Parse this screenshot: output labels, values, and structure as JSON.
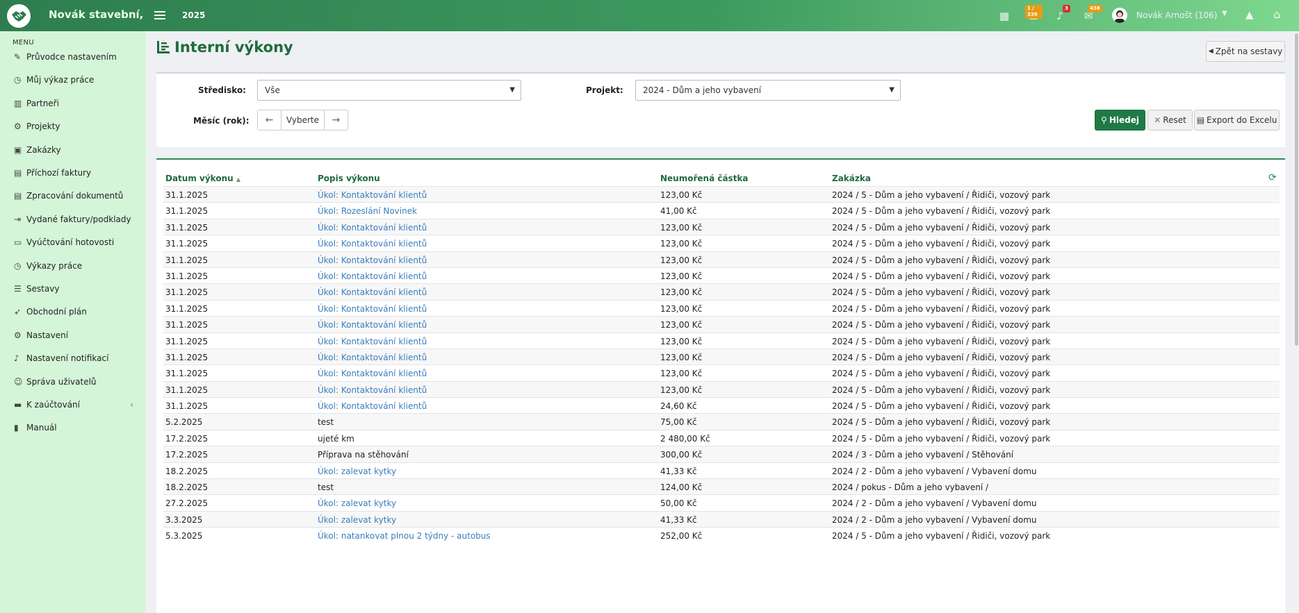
{
  "app": {
    "brand": "Novák stavební,",
    "year": "2025"
  },
  "navbar": {
    "tasks_badge": "1 / 339",
    "notifications_badge": "3",
    "messages_badge": "438",
    "user_name": "Novák Arnošt (106)"
  },
  "sidebar": {
    "heading": "MENU",
    "items": [
      {
        "label": "Průvodce nastavením",
        "icon": "✎"
      },
      {
        "label": "Můj výkaz práce",
        "icon": "◷"
      },
      {
        "label": "Partneři",
        "icon": "▥"
      },
      {
        "label": "Projekty",
        "icon": "⚙"
      },
      {
        "label": "Zakázky",
        "icon": "▣"
      },
      {
        "label": "Příchozí faktury",
        "icon": "▤"
      },
      {
        "label": "Zpracování dokumentů",
        "icon": "▤"
      },
      {
        "label": "Vydané faktury/podklady",
        "icon": "⇥"
      },
      {
        "label": "Vyúčtování hotovosti",
        "icon": "▭"
      },
      {
        "label": "Výkazy práce",
        "icon": "◷"
      },
      {
        "label": "Sestavy",
        "icon": "☰"
      },
      {
        "label": "Obchodní plán",
        "icon": "➶"
      },
      {
        "label": "Nastavení",
        "icon": "⚙"
      },
      {
        "label": "Nastavení notifikací",
        "icon": "♪"
      },
      {
        "label": "Správa uživatelů",
        "icon": "☺"
      },
      {
        "label": "K zaúčtování",
        "icon": "▬"
      },
      {
        "label": "Manuál",
        "icon": "▮"
      }
    ]
  },
  "page": {
    "title": "Interní výkony",
    "back_label": "Zpět na sestavy"
  },
  "filters": {
    "center_label": "Středisko:",
    "center_value": "Vše",
    "project_label": "Projekt:",
    "project_value": "2024 - Dům a jeho vybavení",
    "month_label": "Měsíc (rok):",
    "month_value": "Vyberte",
    "search_label": "Hledej",
    "reset_label": "Reset",
    "export_label": "Export do Excelu"
  },
  "table": {
    "columns": [
      "Datum výkonu",
      "Popis výkonu",
      "Neumořená částka",
      "Zakázka"
    ],
    "rows": [
      {
        "date": "31.1.2025",
        "desc": "Úkol: Kontaktování klientů",
        "link": true,
        "amount": "123,00 Kč",
        "order": "2024 / 5 - Dům a jeho vybavení / Řidiči, vozový park"
      },
      {
        "date": "31.1.2025",
        "desc": "Úkol: Rozeslání Novinek",
        "link": true,
        "amount": "41,00 Kč",
        "order": "2024 / 5 - Dům a jeho vybavení / Řidiči, vozový park"
      },
      {
        "date": "31.1.2025",
        "desc": "Úkol: Kontaktování klientů",
        "link": true,
        "amount": "123,00 Kč",
        "order": "2024 / 5 - Dům a jeho vybavení / Řidiči, vozový park"
      },
      {
        "date": "31.1.2025",
        "desc": "Úkol: Kontaktování klientů",
        "link": true,
        "amount": "123,00 Kč",
        "order": "2024 / 5 - Dům a jeho vybavení / Řidiči, vozový park"
      },
      {
        "date": "31.1.2025",
        "desc": "Úkol: Kontaktování klientů",
        "link": true,
        "amount": "123,00 Kč",
        "order": "2024 / 5 - Dům a jeho vybavení / Řidiči, vozový park"
      },
      {
        "date": "31.1.2025",
        "desc": "Úkol: Kontaktování klientů",
        "link": true,
        "amount": "123,00 Kč",
        "order": "2024 / 5 - Dům a jeho vybavení / Řidiči, vozový park"
      },
      {
        "date": "31.1.2025",
        "desc": "Úkol: Kontaktování klientů",
        "link": true,
        "amount": "123,00 Kč",
        "order": "2024 / 5 - Dům a jeho vybavení / Řidiči, vozový park"
      },
      {
        "date": "31.1.2025",
        "desc": "Úkol: Kontaktování klientů",
        "link": true,
        "amount": "123,00 Kč",
        "order": "2024 / 5 - Dům a jeho vybavení / Řidiči, vozový park"
      },
      {
        "date": "31.1.2025",
        "desc": "Úkol: Kontaktování klientů",
        "link": true,
        "amount": "123,00 Kč",
        "order": "2024 / 5 - Dům a jeho vybavení / Řidiči, vozový park"
      },
      {
        "date": "31.1.2025",
        "desc": "Úkol: Kontaktování klientů",
        "link": true,
        "amount": "123,00 Kč",
        "order": "2024 / 5 - Dům a jeho vybavení / Řidiči, vozový park"
      },
      {
        "date": "31.1.2025",
        "desc": "Úkol: Kontaktování klientů",
        "link": true,
        "amount": "123,00 Kč",
        "order": "2024 / 5 - Dům a jeho vybavení / Řidiči, vozový park"
      },
      {
        "date": "31.1.2025",
        "desc": "Úkol: Kontaktování klientů",
        "link": true,
        "amount": "123,00 Kč",
        "order": "2024 / 5 - Dům a jeho vybavení / Řidiči, vozový park"
      },
      {
        "date": "31.1.2025",
        "desc": "Úkol: Kontaktování klientů",
        "link": true,
        "amount": "123,00 Kč",
        "order": "2024 / 5 - Dům a jeho vybavení / Řidiči, vozový park"
      },
      {
        "date": "31.1.2025",
        "desc": "Úkol: Kontaktování klientů",
        "link": true,
        "amount": "24,60 Kč",
        "order": "2024 / 5 - Dům a jeho vybavení / Řidiči, vozový park"
      },
      {
        "date": "5.2.2025",
        "desc": "test",
        "link": false,
        "amount": "75,00 Kč",
        "order": "2024 / 5 - Dům a jeho vybavení / Řidiči, vozový park"
      },
      {
        "date": "17.2.2025",
        "desc": "ujeté km",
        "link": false,
        "amount": "2 480,00 Kč",
        "order": "2024 / 5 - Dům a jeho vybavení / Řidiči, vozový park"
      },
      {
        "date": "17.2.2025",
        "desc": "Příprava na stěhování",
        "link": false,
        "amount": "300,00 Kč",
        "order": "2024 / 3 - Dům a jeho vybavení / Stěhování"
      },
      {
        "date": "18.2.2025",
        "desc": "Úkol: zalevat kytky",
        "link": true,
        "amount": "41,33 Kč",
        "order": "2024 / 2 - Dům a jeho vybavení / Vybavení domu"
      },
      {
        "date": "18.2.2025",
        "desc": "test",
        "link": false,
        "amount": "124,00 Kč",
        "order": "2024 / pokus - Dům a jeho vybavení /"
      },
      {
        "date": "27.2.2025",
        "desc": "Úkol: zalevat kytky",
        "link": true,
        "amount": "50,00 Kč",
        "order": "2024 / 2 - Dům a jeho vybavení / Vybavení domu"
      },
      {
        "date": "3.3.2025",
        "desc": "Úkol: zalevat kytky",
        "link": true,
        "amount": "41,33 Kč",
        "order": "2024 / 2 - Dům a jeho vybavení / Vybavení domu"
      },
      {
        "date": "5.3.2025",
        "desc": "Úkol: natankovat plnou 2 týdny - autobus",
        "link": true,
        "amount": "252,00 Kč",
        "order": "2024 / 5 - Dům a jeho vybavení / Řidiči, vozový park"
      }
    ]
  },
  "colors": {
    "brand_green": "#1f6b3c",
    "link_blue": "#3b7dbb",
    "sidebar_bg": "#d4f5d8"
  }
}
